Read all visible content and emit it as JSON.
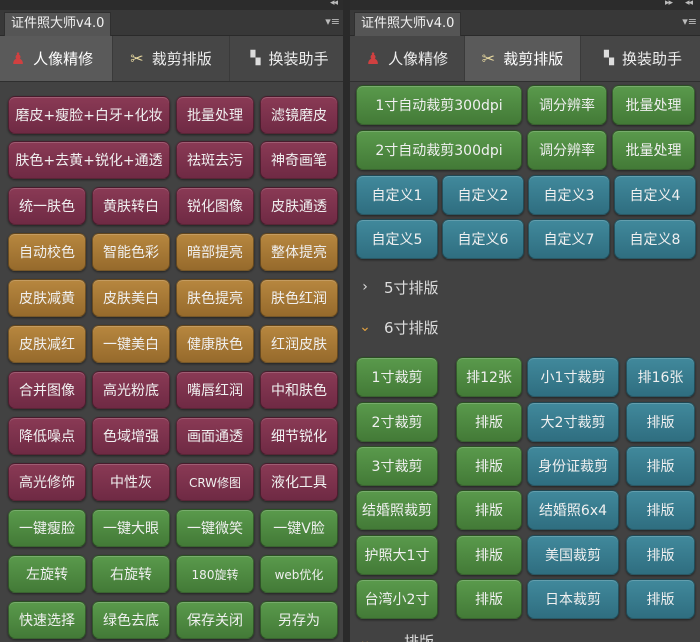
{
  "left": {
    "title": "证件照大师v4.0",
    "tabs": [
      {
        "label": "人像精修",
        "icon": "person-icon"
      },
      {
        "label": "裁剪排版",
        "icon": "scissors-icon"
      },
      {
        "label": "换装助手",
        "icon": "suit-icon"
      }
    ],
    "grid": [
      [
        "磨皮+瘦脸+白牙+化妆",
        "批量处理",
        "滤镜磨皮"
      ],
      [
        "肤色+去黄+锐化+通透",
        "祛斑去污",
        "神奇画笔"
      ],
      [
        "统一肤色",
        "黄肤转白",
        "锐化图像",
        "皮肤通透"
      ],
      [
        "自动校色",
        "智能色彩",
        "暗部提亮",
        "整体提亮"
      ],
      [
        "皮肤减黄",
        "皮肤美白",
        "肤色提亮",
        "肤色红润"
      ],
      [
        "皮肤减红",
        "一键美白",
        "健康肤色",
        "红润皮肤"
      ],
      [
        "合并图像",
        "高光粉底",
        "嘴唇红润",
        "中和肤色"
      ],
      [
        "降低噪点",
        "色域增强",
        "画面通透",
        "细节锐化"
      ],
      [
        "高光修饰",
        "中性灰",
        "CRW修图",
        "液化工具"
      ],
      [
        "一键瘦脸",
        "一键大眼",
        "一键微笑",
        "一键V脸"
      ],
      [
        "左旋转",
        "右旋转",
        "180旋转",
        "web优化"
      ],
      [
        "快速选择",
        "绿色去底",
        "保存关闭",
        "另存为"
      ]
    ]
  },
  "right": {
    "title": "证件照大师v4.0",
    "tabs": [
      {
        "label": "人像精修",
        "icon": "person-icon"
      },
      {
        "label": "裁剪排版",
        "icon": "scissors-icon"
      },
      {
        "label": "换装助手",
        "icon": "suit-icon"
      }
    ],
    "top_rows": [
      [
        "1寸自动裁剪300dpi",
        "调分辨率",
        "批量处理"
      ],
      [
        "2寸自动裁剪300dpi",
        "调分辨率",
        "批量处理"
      ]
    ],
    "custom": [
      "自定义1",
      "自定义2",
      "自定义3",
      "自定义4",
      "自定义5",
      "自定义6",
      "自定义7",
      "自定义8"
    ],
    "sections": [
      {
        "label": "5寸排版",
        "expanded": false
      },
      {
        "label": "6寸排版",
        "expanded": true
      }
    ],
    "six_inch_rows": [
      [
        "1寸裁剪",
        "排12张",
        "小1寸裁剪",
        "排16张"
      ],
      [
        "2寸裁剪",
        "排版",
        "大2寸裁剪",
        "排版"
      ],
      [
        "3寸裁剪",
        "排版",
        "身份证裁剪",
        "排版"
      ],
      [
        "结婚照裁剪",
        "排版",
        "结婚照6x4",
        "排版"
      ],
      [
        "护照大1寸",
        "排版",
        "美国裁剪",
        "排版"
      ],
      [
        "台湾小2寸",
        "排版",
        "日本裁剪",
        "排版"
      ]
    ],
    "bottom_partial": "排版"
  },
  "colors": {
    "maroon": "#7d3350",
    "orange": "#a87a36",
    "green": "#4f8a42",
    "teal": "#38798c",
    "panel": "#424242"
  }
}
